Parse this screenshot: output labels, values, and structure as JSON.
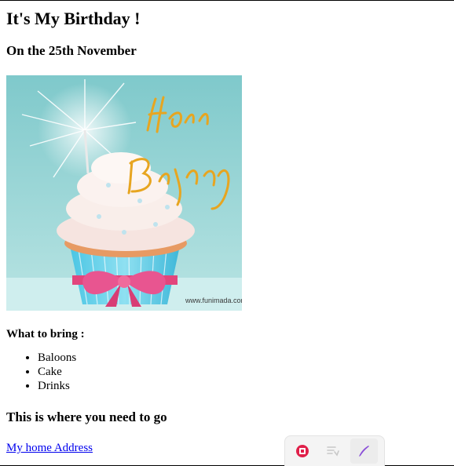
{
  "page": {
    "title": "It's My Birthday !",
    "date": "On the 25th November",
    "image_watermark": "www.funimada.com",
    "image_lettering": "Happy Birthday",
    "bring_label": "What to bring :",
    "bring_items": [
      "Baloons",
      "Cake",
      "Drinks"
    ],
    "where_heading": "This is where you need to go",
    "address_link": "My home Address"
  },
  "toolbar": {
    "tools": [
      {
        "icon": "record-icon",
        "color": "#e0204a"
      },
      {
        "icon": "list-icon",
        "color": "#c8c8c8"
      },
      {
        "icon": "pen-icon",
        "color": "#8a4fd8"
      }
    ]
  },
  "colors": {
    "link": "#0000ee",
    "image_background": "#8fd1d2"
  }
}
